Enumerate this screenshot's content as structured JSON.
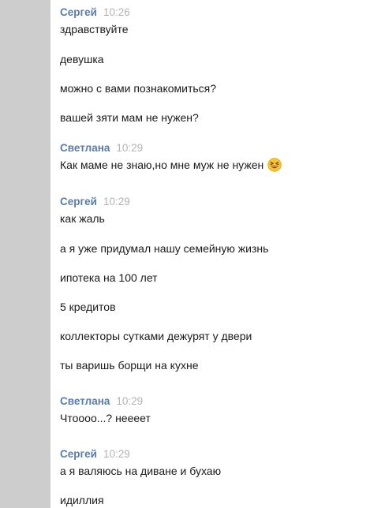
{
  "colors": {
    "left_strip": "#cdcdcd",
    "sender_name": "#5a7ca8",
    "timestamp": "#b3b3b3",
    "message_text": "#1a1a1a"
  },
  "groups": [
    {
      "sender": "Сергей",
      "time": "10:26",
      "messages": [
        "здравствуйте",
        "девушка",
        "можно с вами познакомиться?",
        "вашей зяти мам не нужен?"
      ]
    },
    {
      "sender": "Светлана",
      "time": "10:29",
      "messages": [
        "Как маме не знаю,но мне муж не нужен"
      ],
      "emoji": "laughing-face"
    },
    {
      "sender": "Сергей",
      "time": "10:29",
      "messages": [
        "как жаль",
        "а я уже придумал нашу семейную жизнь",
        "ипотека на 100 лет",
        "5 кредитов",
        "коллекторы сутками дежурят у двери",
        "ты варишь борщи на кухне"
      ]
    },
    {
      "sender": "Светлана",
      "time": "10:29",
      "messages": [
        "Чтоооо...? нееeет"
      ]
    },
    {
      "sender": "Сергей",
      "time": "10:29",
      "messages": [
        "а я валяюсь на диване и бухаю",
        "идиллия"
      ]
    }
  ]
}
